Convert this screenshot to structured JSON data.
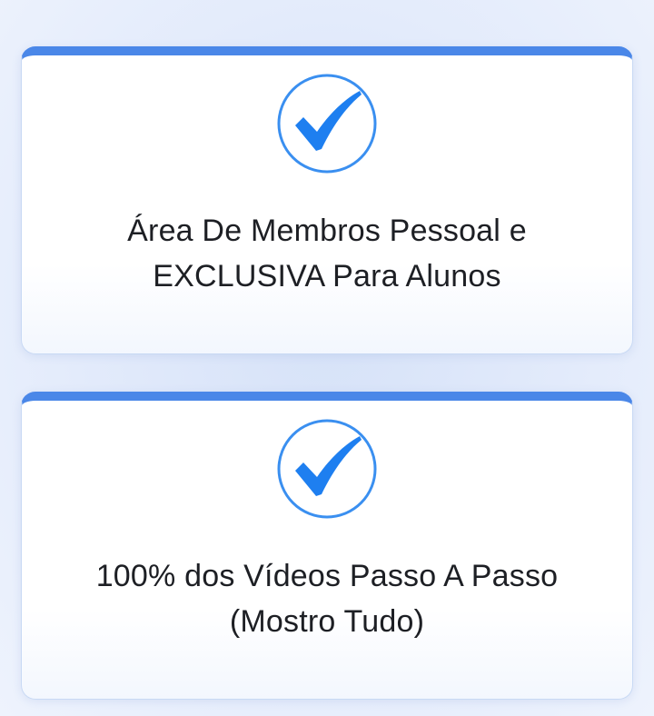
{
  "colors": {
    "accent": "#4a87e8",
    "check_circle": "#3a8ff0",
    "check_mark": "#1e7ff0",
    "text": "#1d1f24"
  },
  "cards": [
    {
      "icon": "check-circle-icon",
      "line1": "Área De Membros Pessoal e",
      "line2": "EXCLUSIVA Para Alunos"
    },
    {
      "icon": "check-circle-icon",
      "line1": "100% dos Vídeos Passo A Passo",
      "line2": "(Mostro Tudo)"
    }
  ]
}
